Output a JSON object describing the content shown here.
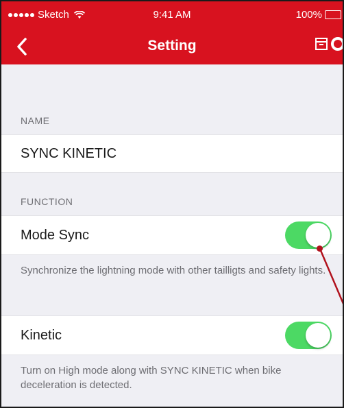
{
  "status_bar": {
    "carrier": "Sketch",
    "time": "9:41 AM",
    "battery": "100%"
  },
  "nav": {
    "title": "Setting",
    "back_icon": "chevron-left-icon",
    "right_icons": [
      "archive-icon",
      "circle-icon"
    ]
  },
  "sections": {
    "name": {
      "header": "NAME",
      "value": "SYNC KINETIC"
    },
    "function": {
      "header": "FUNCTION",
      "mode_sync": {
        "label": "Mode Sync",
        "enabled": true,
        "description": "Synchronize the lightning mode with other tailligts and safety lights."
      },
      "kinetic": {
        "label": "Kinetic",
        "enabled": true,
        "description": "Turn on High mode along with SYNC KINETIC when bike deceleration is detected."
      }
    }
  },
  "colors": {
    "brand_red": "#d8121f",
    "toggle_on": "#4cd964",
    "background": "#efeff4",
    "annotation": "#b1121d"
  }
}
